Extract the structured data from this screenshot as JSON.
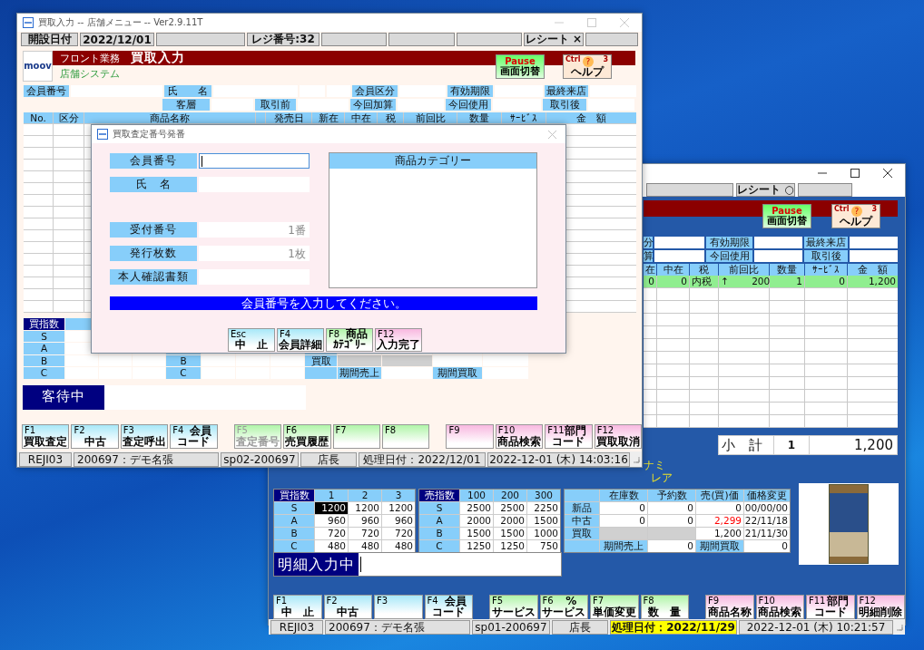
{
  "back_window": {
    "receipt_status": "レシート ○",
    "banner_buttons": [
      {
        "kind": "pause",
        "key": "Pause",
        "label": "画面切替"
      },
      {
        "kind": "help",
        "key": "Ctrl",
        "number": "3",
        "icon": "?",
        "label": "ヘルプ"
      }
    ],
    "info_rows": [
      [
        "分",
        "有効期限",
        "最終来店"
      ],
      [
        "算",
        "今回使用",
        "取引後"
      ]
    ],
    "table": {
      "columns": [
        "在",
        "中在",
        "税",
        "前回比",
        "数量",
        "ｻｰﾋﾞｽ",
        "金　額"
      ],
      "rows": [
        {
          "selected": true,
          "cells": [
            "0",
            "0",
            "内税",
            "↑　　 200",
            "1",
            "0",
            "1,200"
          ]
        }
      ]
    },
    "subtotal": {
      "label": "小　計",
      "quantity": "1",
      "amount": "1,200"
    },
    "product_text": [
      "ナミ",
      "レア"
    ],
    "buy_index": {
      "header": "買指数",
      "columns": [
        "1",
        "2",
        "3"
      ],
      "rows": [
        {
          "grade": "S",
          "cells": [
            {
              "text": "1200",
              "selected": true
            },
            {
              "text": "1200",
              "selected": false
            },
            {
              "text": "1200",
              "selected": false
            }
          ]
        },
        {
          "grade": "A",
          "cells": [
            {
              "text": "960",
              "selected": false
            },
            {
              "text": "960",
              "selected": false
            },
            {
              "text": "960",
              "selected": false
            }
          ]
        },
        {
          "grade": "B",
          "cells": [
            {
              "text": "720",
              "selected": false
            },
            {
              "text": "720",
              "selected": false
            },
            {
              "text": "720",
              "selected": false
            }
          ]
        },
        {
          "grade": "C",
          "cells": [
            {
              "text": "480",
              "selected": false
            },
            {
              "text": "480",
              "selected": false
            },
            {
              "text": "480",
              "selected": false
            }
          ]
        }
      ]
    },
    "sell_index": {
      "header": "売指数",
      "columns": [
        "100",
        "200",
        "300"
      ],
      "rows": [
        {
          "grade": "S",
          "cells": [
            "2500",
            "2500",
            "2250"
          ]
        },
        {
          "grade": "A",
          "cells": [
            "2000",
            "2000",
            "1500"
          ]
        },
        {
          "grade": "B",
          "cells": [
            "1500",
            "1500",
            "1000"
          ]
        },
        {
          "grade": "C",
          "cells": [
            "1250",
            "1250",
            "750"
          ]
        }
      ]
    },
    "stock_table": {
      "columns": [
        "在庫数",
        "予約数",
        "売(買)価",
        "価格変更"
      ],
      "rows": [
        {
          "label": "新品",
          "cells": [
            {
              "kind": "value",
              "text": "0",
              "warning": false
            },
            {
              "kind": "value",
              "text": "0",
              "warning": false
            },
            {
              "kind": "value",
              "text": "0",
              "warning": false
            },
            {
              "kind": "value",
              "text": "00/00/00",
              "warning": false
            }
          ]
        },
        {
          "label": "中古",
          "cells": [
            {
              "kind": "value",
              "text": "0",
              "warning": false
            },
            {
              "kind": "value",
              "text": "0",
              "warning": false
            },
            {
              "kind": "value",
              "text": "2,299",
              "warning": true
            },
            {
              "kind": "value",
              "text": "22/11/18",
              "warning": false
            }
          ]
        },
        {
          "label": "買取",
          "cells": [
            {
              "kind": "blank"
            },
            {
              "kind": "blank"
            },
            {
              "kind": "value",
              "text": "1,200",
              "warning": false
            },
            {
              "kind": "value",
              "text": "21/11/30",
              "warning": false
            }
          ]
        }
      ],
      "footer": {
        "sales_label": "期間売上",
        "sales": "0",
        "buy_label": "期間買取",
        "buy": "0"
      }
    },
    "input_status": "明細入力中",
    "function_keys": [
      {
        "key": "F1",
        "kind": "blue",
        "lines": [
          "中　止"
        ]
      },
      {
        "key": "F2",
        "kind": "blue",
        "lines": [
          "中古"
        ]
      },
      {
        "key": "F3",
        "kind": "blue"
      },
      {
        "key": "F4",
        "kind": "blue",
        "lines": [
          "会員",
          "コード"
        ]
      },
      {
        "key": "F5",
        "kind": "green",
        "lines": [
          "サービス"
        ]
      },
      {
        "key": "F6",
        "kind": "green",
        "lines": [
          "%",
          "サービス"
        ]
      },
      {
        "key": "F7",
        "kind": "green",
        "lines": [
          "単価変更"
        ]
      },
      {
        "key": "F8",
        "kind": "green",
        "lines": [
          "数　量"
        ]
      },
      {
        "key": "F9",
        "kind": "pink",
        "lines": [
          "商品名称"
        ]
      },
      {
        "key": "F10",
        "kind": "pink",
        "lines": [
          "商品検索"
        ]
      },
      {
        "key": "F11",
        "kind": "pink",
        "lines": [
          "部門",
          "コード"
        ]
      },
      {
        "key": "F12",
        "kind": "pink",
        "lines": [
          "明細削除"
        ]
      }
    ],
    "status_bar": [
      {
        "text": "REJI03",
        "highlight": false
      },
      {
        "text": "200697：デモ名張",
        "highlight": false
      },
      {
        "text": "sp01-200697",
        "highlight": false
      },
      {
        "text": "店長",
        "highlight": false
      },
      {
        "text": "処理日付：2022/11/29",
        "highlight": true
      },
      {
        "text": "2022-12-01 (木) 10:21:57",
        "highlight": false
      }
    ]
  },
  "front_window": {
    "title": "買取入力 -- 店舗メニュー -- Ver2.9.11T",
    "top_status": [
      "開設日付",
      "2022/12/01",
      "レジ番号:32",
      "レシート ×"
    ],
    "banner": {
      "logo": "moov",
      "department": "フロント業務",
      "title": "買取入力",
      "subtitle": "店舗システム"
    },
    "banner_buttons": [
      {
        "kind": "pause",
        "key": "Pause",
        "label": "画面切替"
      },
      {
        "kind": "help",
        "key": "Ctrl",
        "number": "3",
        "icon": "?",
        "label": "ヘルプ"
      }
    ],
    "info_rows": [
      [
        {
          "kind": "label",
          "text": "会員番号"
        },
        {
          "kind": "field"
        },
        {
          "kind": "label",
          "text": "氏　　名"
        },
        {
          "kind": "field"
        },
        {
          "kind": "field"
        },
        {
          "kind": "field"
        },
        {
          "kind": "label",
          "text": "会員区分"
        },
        {
          "kind": "field"
        },
        {
          "kind": "label",
          "text": "有効期限"
        },
        {
          "kind": "field"
        },
        {
          "kind": "label",
          "text": "最終来店"
        },
        {
          "kind": "field"
        }
      ],
      [
        {
          "kind": "label",
          "text": "客層"
        },
        {
          "kind": "field"
        },
        {
          "kind": "label",
          "text": "取引前"
        },
        {
          "kind": "field"
        },
        {
          "kind": "label",
          "text": "今回加算"
        },
        {
          "kind": "field"
        },
        {
          "kind": "label",
          "text": "今回使用"
        },
        {
          "kind": "field"
        },
        {
          "kind": "label",
          "text": "取引後"
        },
        {
          "kind": "field"
        }
      ]
    ],
    "table": {
      "columns": [
        "No.",
        "区分",
        "商品名称",
        "",
        "発売日",
        "新在",
        "中在",
        "税",
        "前回比",
        "数量",
        "ｻｰﾋﾞｽ",
        "金　額"
      ]
    },
    "buy_index": {
      "header": "買指数",
      "grades": [
        "S",
        "A",
        "B",
        "C"
      ]
    },
    "sell_index": {
      "grades": [
        "B",
        "C"
      ]
    },
    "stock_labels": {
      "row": "買取",
      "sales": "期間売上",
      "buy": "期間買取"
    },
    "input_status": "客待中",
    "function_keys": [
      {
        "key": "F1",
        "kind": "blue",
        "disabled": false,
        "lines": [
          "買取査定"
        ]
      },
      {
        "key": "F2",
        "kind": "blue",
        "disabled": false,
        "lines": [
          "中古"
        ]
      },
      {
        "key": "F3",
        "kind": "blue",
        "disabled": false,
        "lines": [
          "査定呼出"
        ]
      },
      {
        "key": "F4",
        "kind": "blue",
        "disabled": false,
        "lines": [
          "会員",
          "コード"
        ]
      },
      {
        "key": "F5",
        "kind": "green",
        "disabled": true,
        "lines": [
          "査定番号"
        ]
      },
      {
        "key": "F6",
        "kind": "green",
        "disabled": false,
        "lines": [
          "売買履歴"
        ]
      },
      {
        "key": "F7",
        "kind": "green",
        "disabled": false
      },
      {
        "key": "F8",
        "kind": "green",
        "disabled": false
      },
      {
        "key": "F9",
        "kind": "pink",
        "disabled": false
      },
      {
        "key": "F10",
        "kind": "pink",
        "disabled": false,
        "lines": [
          "商品検索"
        ]
      },
      {
        "key": "F11",
        "kind": "pink",
        "disabled": false,
        "lines": [
          "部門",
          "コード"
        ]
      },
      {
        "key": "F12",
        "kind": "pink",
        "disabled": false,
        "lines": [
          "買取取消"
        ]
      }
    ],
    "status_bar": [
      {
        "text": "REJI03",
        "highlight": false
      },
      {
        "text": "200697：デモ名張",
        "highlight": false
      },
      {
        "text": "sp02-200697",
        "highlight": false
      },
      {
        "text": "店長",
        "highlight": false
      },
      {
        "text": "処理日付：2022/12/01",
        "highlight": false
      },
      {
        "text": "2022-12-01 (木) 14:03:16",
        "highlight": false
      }
    ]
  },
  "dialog": {
    "title": "買取査定番号発番",
    "fields": [
      {
        "label": "会員番号",
        "focused": true
      },
      {
        "label": "氏　名",
        "focused": false
      },
      {
        "label": "受付番号",
        "value": "1番",
        "focused": false
      },
      {
        "label": "発行枚数",
        "value": "1枚",
        "focused": false
      },
      {
        "label": "本人確認書類",
        "focused": false
      }
    ],
    "category_panel": {
      "title": "商品カテゴリー"
    },
    "message": "会員番号を入力してください。",
    "buttons": [
      {
        "key": "Esc",
        "kind": "blue",
        "lines": [
          "中　止"
        ]
      },
      {
        "key": "F4",
        "kind": "blue",
        "lines": [
          "会員詳細"
        ]
      },
      {
        "key": "F8",
        "kind": "green",
        "lines": [
          "商品",
          "ｶﾃｺﾞﾘｰ"
        ]
      },
      {
        "key": "F12",
        "kind": "pink",
        "lines": [
          "入力完了"
        ]
      }
    ]
  }
}
